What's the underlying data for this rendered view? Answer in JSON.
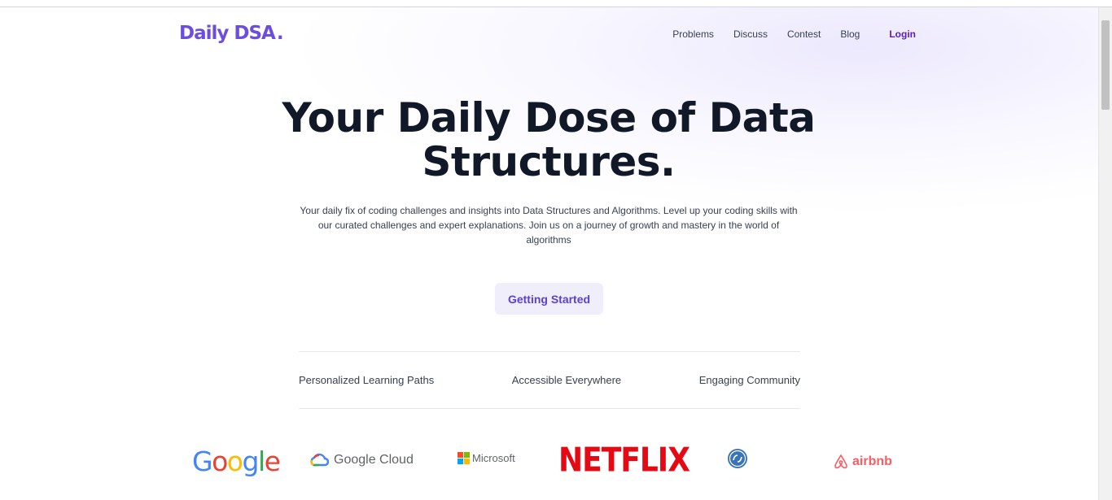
{
  "nav": {
    "logo": "Daily DSA",
    "logo_dot": ".",
    "links": [
      "Problems",
      "Discuss",
      "Contest",
      "Blog"
    ],
    "login": "Login"
  },
  "hero": {
    "title": "Your Daily Dose of Data Structures.",
    "subtitle": "Your daily fix of coding challenges and insights into Data Structures and Algorithms. Level up your coding skills with our curated challenges and expert explanations. Join us on a journey of growth and mastery in the world of algorithms",
    "cta": "Getting Started"
  },
  "features": [
    "Personalized Learning Paths",
    "Accessible Everywhere",
    "Engaging Community"
  ],
  "brands": {
    "google": "Google",
    "google_cloud": "Google Cloud",
    "microsoft": "Microsoft",
    "netflix": "NETFLIX",
    "ge_icon": "ge-logo-icon",
    "airbnb": "airbnb"
  },
  "colors": {
    "brand": "#6d4de0",
    "login": "#5b21b6",
    "cta_bg": "#f1eefc",
    "netflix": "#e50914",
    "airbnb": "#ff5a5f"
  }
}
